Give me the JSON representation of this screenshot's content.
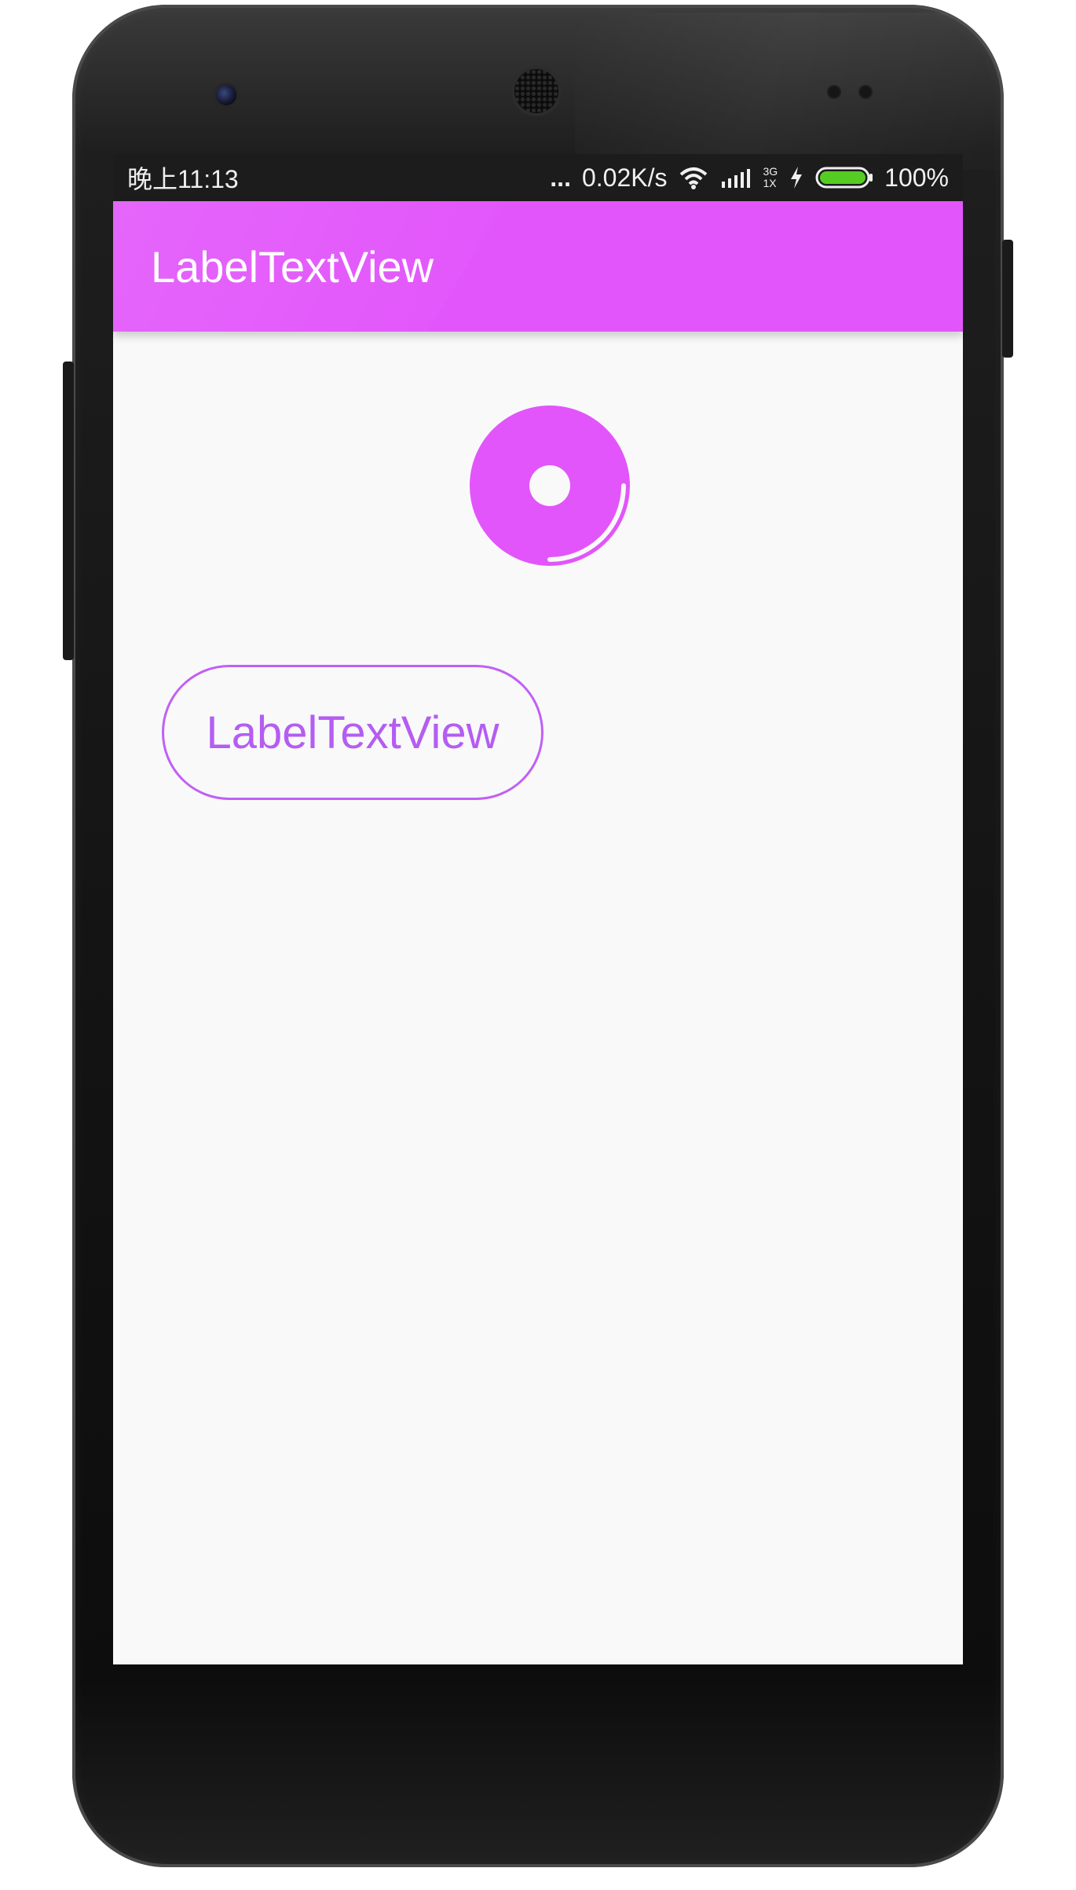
{
  "status_bar": {
    "time": "晚上11:13",
    "more": "...",
    "speed": "0.02K/s",
    "network_top": "3G",
    "network_bottom": "1X",
    "battery": "100%"
  },
  "app_bar": {
    "title": "LabelTextView"
  },
  "main": {
    "label_view_text": "LabelTextView"
  },
  "icons": {
    "center": "disc-icon",
    "wifi": "wifi-icon",
    "signal": "signal-icon",
    "charging": "lightning-icon",
    "battery": "battery-icon"
  },
  "colors": {
    "accent": "#e255fb",
    "label_border": "#c060f5",
    "label_text": "#b45df2",
    "battery_fill": "#55cc22"
  },
  "battery_level": 1.0
}
